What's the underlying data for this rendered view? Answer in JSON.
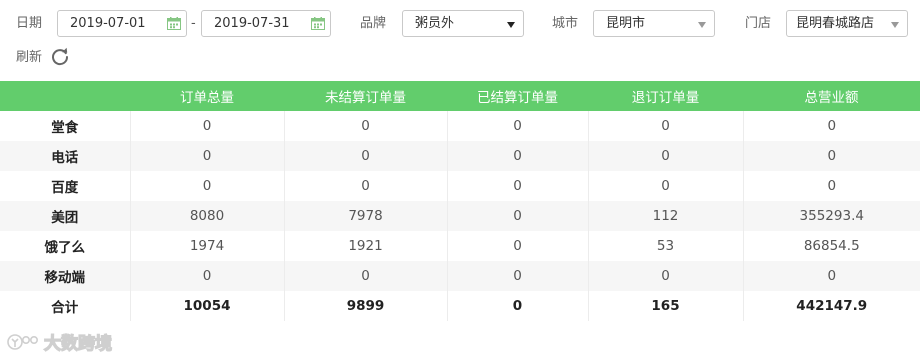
{
  "filters": {
    "date_label": "日期",
    "start_date": "2019-07-01",
    "date_separator": "-",
    "end_date": "2019-07-31",
    "brand_label": "品牌",
    "brand_value": "粥员外",
    "city_label": "城市",
    "city_value": "昆明市",
    "store_label": "门店",
    "store_value": "昆明春城路店",
    "refresh_label": "刷新"
  },
  "table": {
    "headers": [
      "",
      "订单总量",
      "未结算订单量",
      "已结算订单量",
      "退订订单量",
      "总营业额"
    ],
    "rows": [
      [
        "堂食",
        "0",
        "0",
        "0",
        "0",
        "0"
      ],
      [
        "电话",
        "0",
        "0",
        "0",
        "0",
        "0"
      ],
      [
        "百度",
        "0",
        "0",
        "0",
        "0",
        "0"
      ],
      [
        "美团",
        "8080",
        "7978",
        "0",
        "112",
        "355293.4"
      ],
      [
        "饿了么",
        "1974",
        "1921",
        "0",
        "53",
        "86854.5"
      ],
      [
        "移动端",
        "0",
        "0",
        "0",
        "0",
        "0"
      ],
      [
        "合计",
        "10054",
        "9899",
        "0",
        "165",
        "442147.9"
      ]
    ]
  },
  "watermark": {
    "text": "大数跨境"
  },
  "colors": {
    "header_green": "#62cd6c",
    "calendar_icon": "#86c683",
    "alt_row": "#f6f6f6"
  }
}
